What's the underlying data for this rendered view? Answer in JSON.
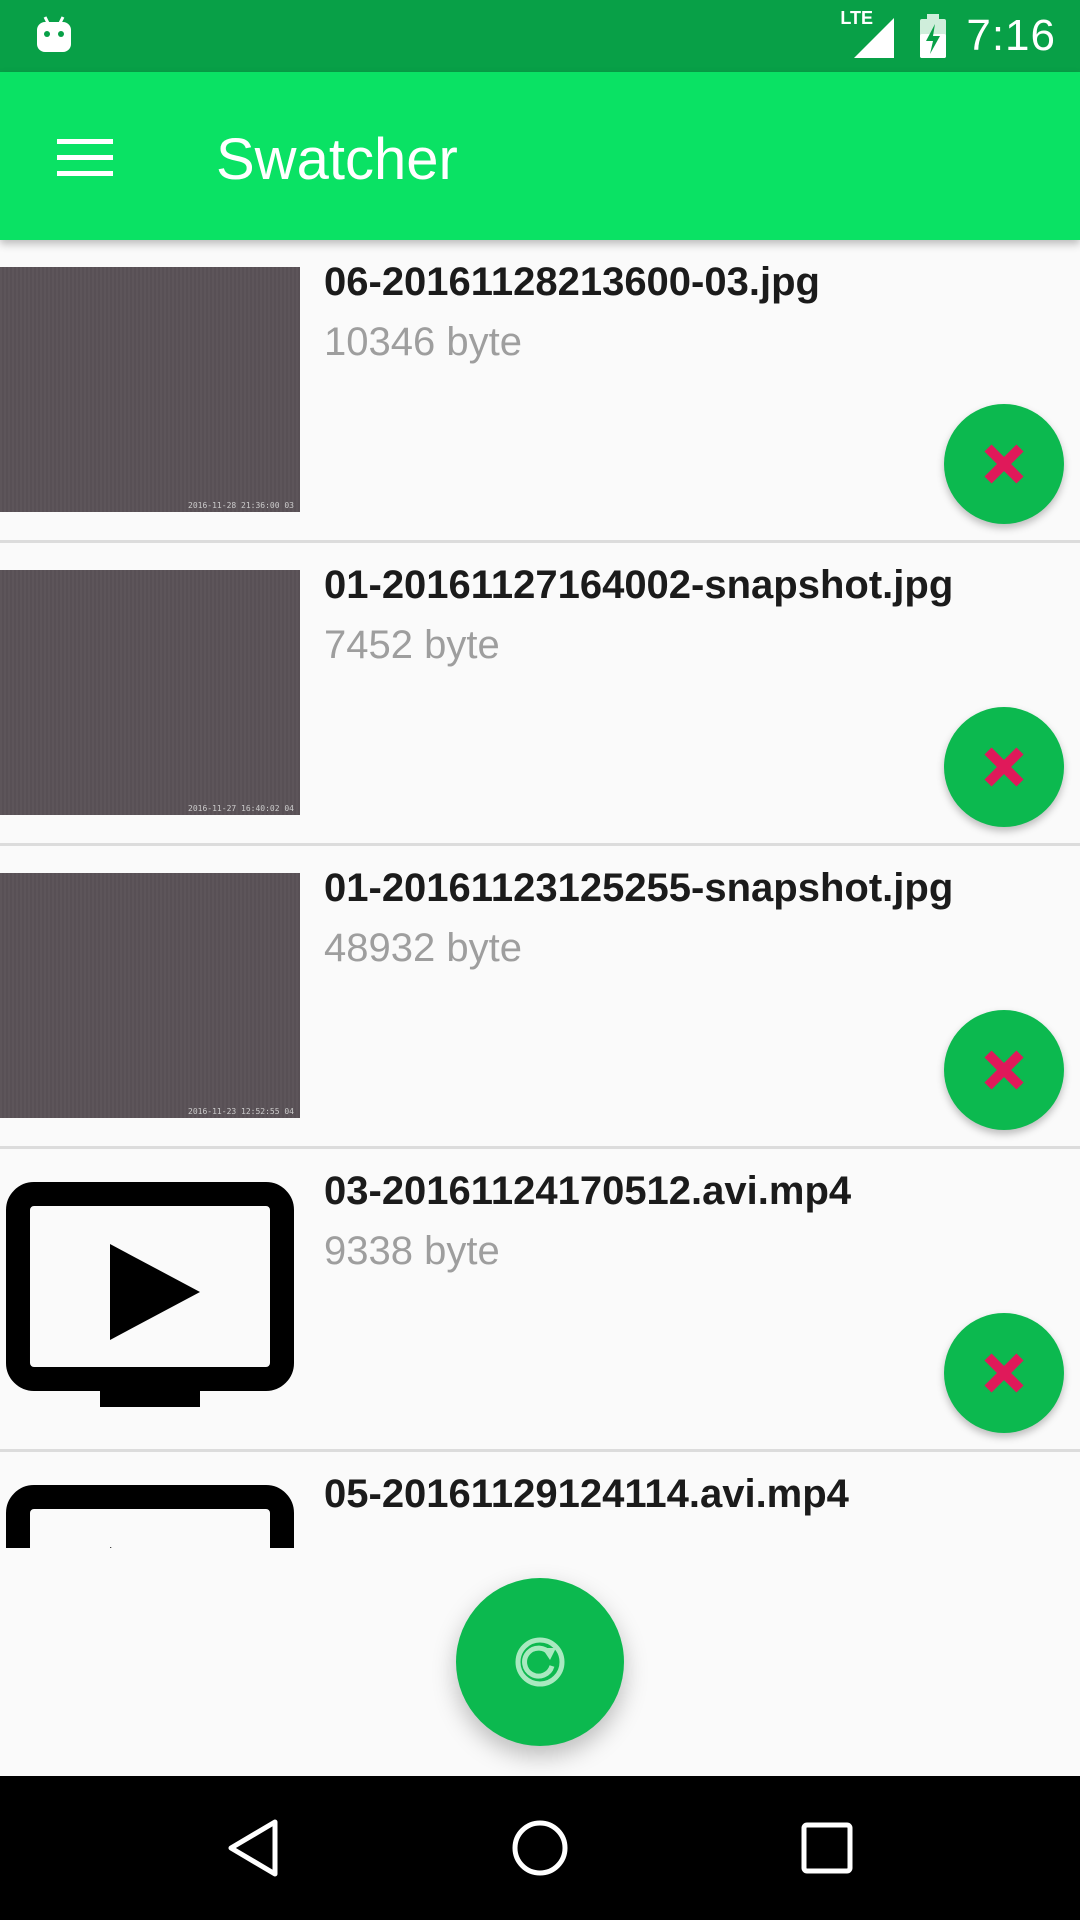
{
  "status_bar": {
    "time": "7:16",
    "network_label": "LTE",
    "icons": [
      "android-robot-icon",
      "signal-icon",
      "battery-charging-icon"
    ]
  },
  "app_bar": {
    "title": "Swatcher",
    "menu_icon": "hamburger-menu-icon"
  },
  "files": [
    {
      "name": "06-20161128213600-03.jpg",
      "size": "10346 byte",
      "thumb_type": "photo",
      "stamp": "2016-11-28 21:36:00 03"
    },
    {
      "name": "01-20161127164002-snapshot.jpg",
      "size": "7452 byte",
      "thumb_type": "photo",
      "stamp": "2016-11-27 16:40:02 04"
    },
    {
      "name": "01-20161123125255-snapshot.jpg",
      "size": "48932 byte",
      "thumb_type": "photo",
      "stamp": "2016-11-23 12:52:55 04"
    },
    {
      "name": "03-20161124170512.avi.mp4",
      "size": "9338 byte",
      "thumb_type": "video"
    },
    {
      "name": "05-20161129124114.avi.mp4",
      "size": "",
      "thumb_type": "video"
    }
  ],
  "actions": {
    "delete_icon": "close-icon",
    "refresh_icon": "refresh-icon"
  },
  "colors": {
    "status_bar": "#08a047",
    "app_bar": "#0ae264",
    "button": "#0cb94f",
    "delete_x": "#e0195a"
  },
  "nav_bar": {
    "buttons": [
      "back-icon",
      "home-icon",
      "recents-icon"
    ]
  }
}
